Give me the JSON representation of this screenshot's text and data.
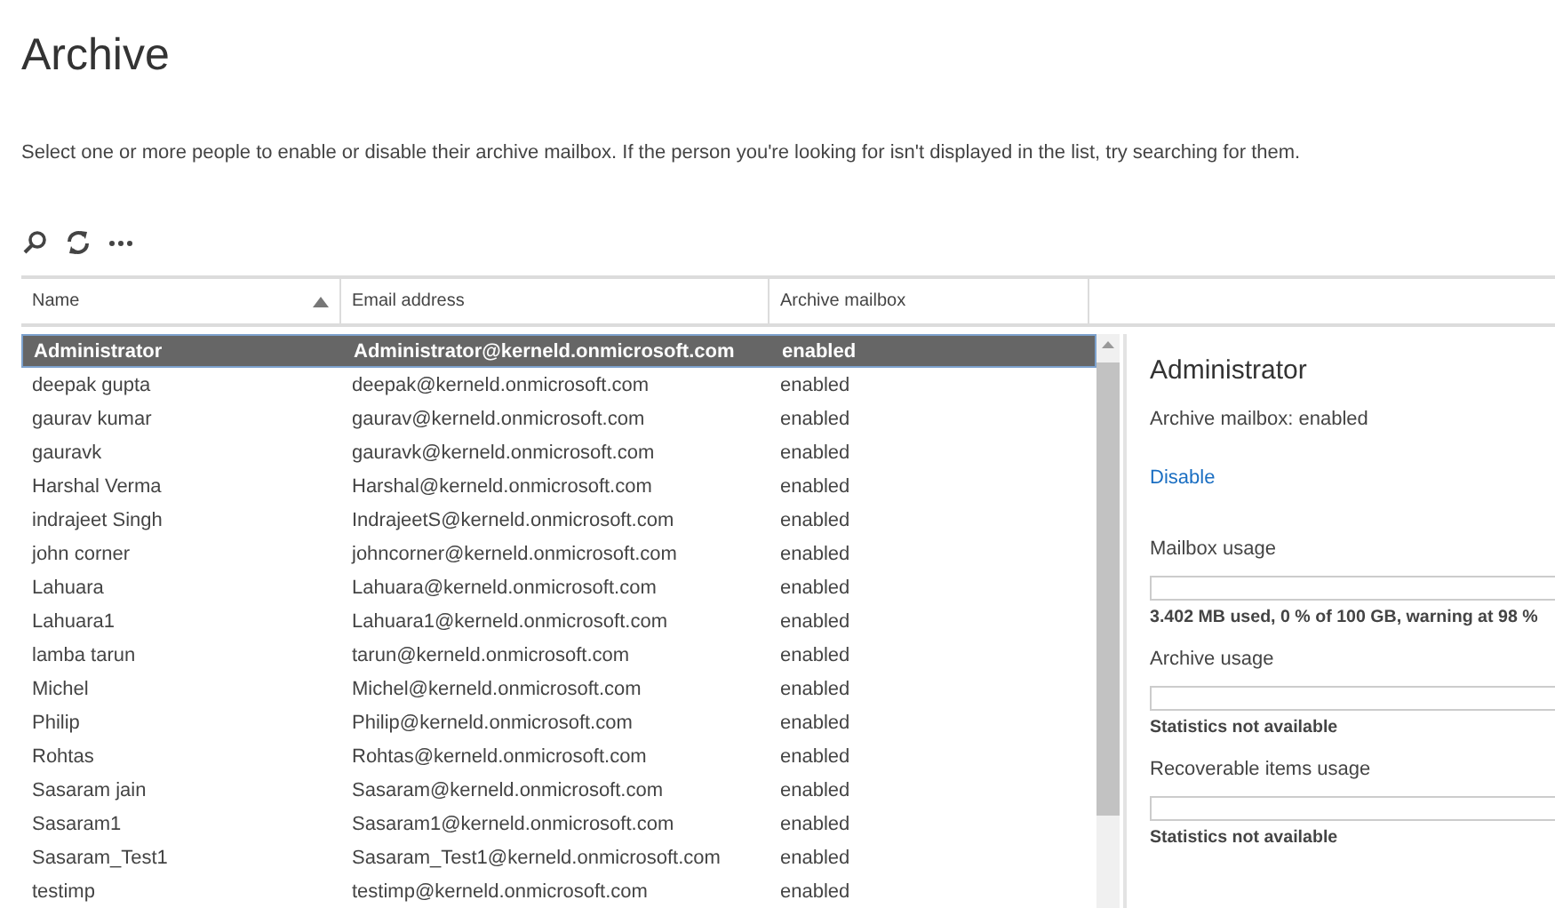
{
  "page": {
    "title": "Archive",
    "description": "Select one or more people to enable or disable their archive mailbox. If the person you're looking for isn't displayed in the list, try searching for them."
  },
  "toolbar": [
    {
      "kind": "search"
    },
    {
      "kind": "refresh"
    },
    {
      "kind": "more"
    }
  ],
  "table": {
    "columns": [
      {
        "label": "Name",
        "sorted": true
      },
      {
        "label": "Email address",
        "sorted": false
      },
      {
        "label": "Archive mailbox",
        "sorted": false
      }
    ],
    "rows": [
      {
        "name": "Administrator",
        "email": "Administrator@kerneld.onmicrosoft.com",
        "archive": "enabled",
        "selected": true
      },
      {
        "name": "deepak gupta",
        "email": "deepak@kerneld.onmicrosoft.com",
        "archive": "enabled",
        "selected": false
      },
      {
        "name": "gaurav kumar",
        "email": "gaurav@kerneld.onmicrosoft.com",
        "archive": "enabled",
        "selected": false
      },
      {
        "name": "gauravk",
        "email": "gauravk@kerneld.onmicrosoft.com",
        "archive": "enabled",
        "selected": false
      },
      {
        "name": "Harshal Verma",
        "email": "Harshal@kerneld.onmicrosoft.com",
        "archive": "enabled",
        "selected": false
      },
      {
        "name": "indrajeet Singh",
        "email": "IndrajeetS@kerneld.onmicrosoft.com",
        "archive": "enabled",
        "selected": false
      },
      {
        "name": "john corner",
        "email": "johncorner@kerneld.onmicrosoft.com",
        "archive": "enabled",
        "selected": false
      },
      {
        "name": "Lahuara",
        "email": "Lahuara@kerneld.onmicrosoft.com",
        "archive": "enabled",
        "selected": false
      },
      {
        "name": "Lahuara1",
        "email": "Lahuara1@kerneld.onmicrosoft.com",
        "archive": "enabled",
        "selected": false
      },
      {
        "name": "lamba tarun",
        "email": "tarun@kerneld.onmicrosoft.com",
        "archive": "enabled",
        "selected": false
      },
      {
        "name": "Michel",
        "email": "Michel@kerneld.onmicrosoft.com",
        "archive": "enabled",
        "selected": false
      },
      {
        "name": "Philip",
        "email": "Philip@kerneld.onmicrosoft.com",
        "archive": "enabled",
        "selected": false
      },
      {
        "name": "Rohtas",
        "email": "Rohtas@kerneld.onmicrosoft.com",
        "archive": "enabled",
        "selected": false
      },
      {
        "name": "Sasaram jain",
        "email": "Sasaram@kerneld.onmicrosoft.com",
        "archive": "enabled",
        "selected": false
      },
      {
        "name": "Sasaram1",
        "email": "Sasaram1@kerneld.onmicrosoft.com",
        "archive": "enabled",
        "selected": false
      },
      {
        "name": "Sasaram_Test1",
        "email": "Sasaram_Test1@kerneld.onmicrosoft.com",
        "archive": "enabled",
        "selected": false
      },
      {
        "name": "testimp",
        "email": "testimp@kerneld.onmicrosoft.com",
        "archive": "enabled",
        "selected": false
      }
    ]
  },
  "details": {
    "title": "Administrator",
    "status": "Archive mailbox: enabled",
    "action": "Disable",
    "usages": [
      {
        "label": "Mailbox usage",
        "level": 0,
        "note": "3.402 MB used, 0 % of 100 GB, warning at 98 %"
      },
      {
        "label": "Archive usage",
        "level": 0,
        "note": "Statistics not available"
      },
      {
        "label": "Recoverable items usage",
        "level": 0,
        "note": "Statistics not available"
      }
    ]
  }
}
